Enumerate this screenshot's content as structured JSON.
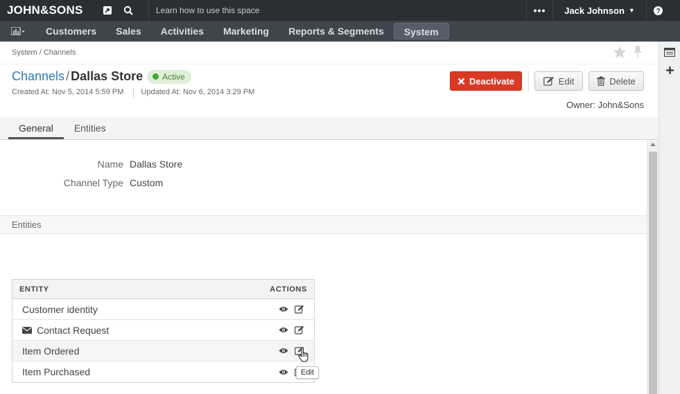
{
  "topbar": {
    "logo": "JOHN&SONS",
    "search_hint": "Learn how to use this space",
    "more_label": "•••",
    "user_name": "Jack Johnson"
  },
  "nav": {
    "items": [
      {
        "label": "Customers"
      },
      {
        "label": "Sales"
      },
      {
        "label": "Activities"
      },
      {
        "label": "Marketing"
      },
      {
        "label": "Reports & Segments"
      },
      {
        "label": "System"
      }
    ],
    "active_index": 5
  },
  "breadcrumb": "System / Channels",
  "header": {
    "parent": "Channels",
    "slash": "/",
    "name": "Dallas Store",
    "status": "Active",
    "created": "Created At: Nov 5, 2014 5:59 PM",
    "updated": "Updated At: Nov 6, 2014 3:29 PM",
    "owner": "Owner: John&Sons"
  },
  "buttons": {
    "deactivate": "Deactivate",
    "edit": "Edit",
    "delete": "Delete"
  },
  "tabs": [
    {
      "label": "General"
    },
    {
      "label": "Entities"
    }
  ],
  "fields": {
    "name_label": "Name",
    "name_value": "Dallas Store",
    "type_label": "Channel Type",
    "type_value": "Custom"
  },
  "entities_section": {
    "title": "Entities",
    "col_entity": "ENTITY",
    "col_actions": "ACTIONS",
    "rows": [
      {
        "name": "Customer identity"
      },
      {
        "name": "Contact Request"
      },
      {
        "name": "Item Ordered"
      },
      {
        "name": "Item Purchased"
      }
    ]
  },
  "tooltip": "Edit",
  "colors": {
    "topbar": "#2b2f33",
    "navbar": "#3e454d",
    "link": "#2f79b9",
    "danger": "#d93a25",
    "active_badge": "#dff0d8"
  }
}
